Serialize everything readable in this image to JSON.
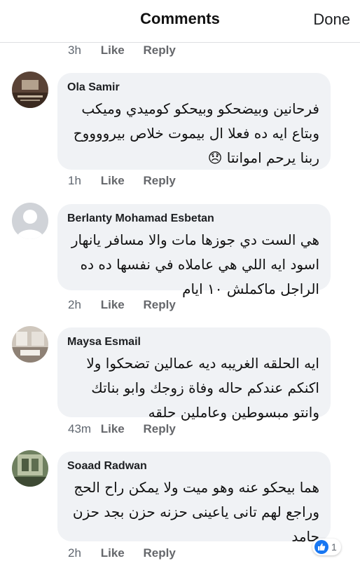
{
  "header": {
    "title": "Comments",
    "done_label": "Done"
  },
  "actions": {
    "like": "Like",
    "reply": "Reply"
  },
  "top_meta": {
    "time": "3h"
  },
  "comments": [
    {
      "author": "Ola Samir",
      "text": "فرحانين وبيضحكو وبيحكو كوميدي وميكب\nوبتاع ايه ده فعلا ال بيموت خلاص بيرووووح\nربنا يرحم اموانتا 😞",
      "time": "1h",
      "avatar": "profile-photo-brown"
    },
    {
      "author": "Berlanty Mohamad Esbetan",
      "text": "هي الست دي جوزها مات والا مسافر يانهار\nاسود ايه اللي هي عاملاه في نفسها ده ده\nالراجل ماكملش ١٠ ايام",
      "time": "2h",
      "avatar": "default-silhouette"
    },
    {
      "author": "Maysa Esmail",
      "text": "ايه الحلقه الغريبه ديه عمالين تضحكوا ولا\nاكنكم عندكم حاله وفاة زوجك وابو بناتك\nوانتو مبسوطين وعاملين حلقه",
      "time": "43m",
      "avatar": "profile-photo-room"
    },
    {
      "author": "Soaad Radwan",
      "text": "هما بيحكو عنه وهو ميت ولا يمكن راح الحج\nوراجع لهم تانى ياعينى حزنه حزن بجد حزن\nجامد",
      "time": "2h",
      "avatar": "profile-photo-green",
      "reaction": {
        "icon": "thumbs-up-icon",
        "count": "1"
      }
    }
  ],
  "colors": {
    "bubble": "#f0f2f5",
    "meta": "#606770",
    "like_blue": "#1877f2"
  }
}
